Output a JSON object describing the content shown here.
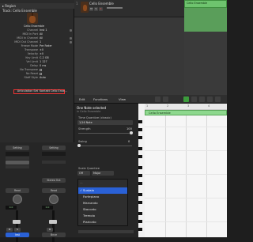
{
  "inspector": {
    "region_header": "▸ Region",
    "track_header": "Track: Cello Ensemble",
    "rows": [
      {
        "label": "",
        "value": "Cello Ensemble"
      },
      {
        "label": "Channel",
        "value": "Inst 1"
      },
      {
        "label": "MIDI In Port",
        "value": "All"
      },
      {
        "label": "MIDI In Channel",
        "value": "All"
      },
      {
        "label": "MIDI Out Channel",
        "value": "1"
      },
      {
        "label": "Freeze Mode",
        "value": "Pre Fader"
      },
      {
        "label": "Transpose",
        "value": "±0"
      },
      {
        "label": "Velocity",
        "value": "±0"
      },
      {
        "label": "Key Limit",
        "value": "C-2  G8"
      },
      {
        "label": "Vel Limit",
        "value": "1  127"
      },
      {
        "label": "Delay",
        "value": "0 ms"
      },
      {
        "label": "No Transpose",
        "value": ""
      },
      {
        "label": "No Reset",
        "value": ""
      },
      {
        "label": "Staff Style",
        "value": "Auto"
      },
      {
        "label": "Articulation Set",
        "value": "Kontakt Cello Ense..."
      }
    ],
    "mixer": {
      "left_strip": {
        "setting": "Setting",
        "eq": "EQ",
        "midi_fx": "MIDI FX",
        "fx": "Audio FX",
        "read": "Read",
        "value": "0.0",
        "mute": "M",
        "solo": "S",
        "io": "Inst"
      },
      "right_strip": {
        "setting": "Setting",
        "eq": "EQ",
        "fx": "Audio FX",
        "stereo_out": "Stereo Out",
        "read": "Read",
        "value": "0.0",
        "mute": "M",
        "io": "Bnce"
      }
    }
  },
  "tracks": {
    "number": "1",
    "name": "Cello Ensemble",
    "mute": "M",
    "solo": "S",
    "rec": "R",
    "region_name": "Cello Ensemble"
  },
  "editor": {
    "menus": [
      "Edit",
      "Functions",
      "View"
    ],
    "quantize": {
      "title": "One Note selected",
      "subtitle": "in Cello Ensemble",
      "time_quantize_label": "Time Quantize (classic)",
      "time_quantize_value": "1/16 Note",
      "strength_label": "Strength",
      "strength_value": "100",
      "swing_label": "Swing",
      "swing_value": "0",
      "scale_quantize_label": "Scale Quantize",
      "scale_off": "Off",
      "scale_major": "Major",
      "velocity_value": "80"
    },
    "articulation_menu": {
      "items": [
        "Sustain",
        "Fortepiano",
        "Marcando",
        "Staccato",
        "Tremolo",
        "Pizzicato"
      ],
      "selected": "Sustain"
    },
    "piano_roll": {
      "region_name": "Cello Ensemble",
      "bar_labels": [
        "1",
        "2",
        "3",
        "4"
      ]
    }
  },
  "colors": {
    "region_green": "#6ec46e",
    "menu_selection": "#2a61d6",
    "highlight_border": "#e33333"
  }
}
